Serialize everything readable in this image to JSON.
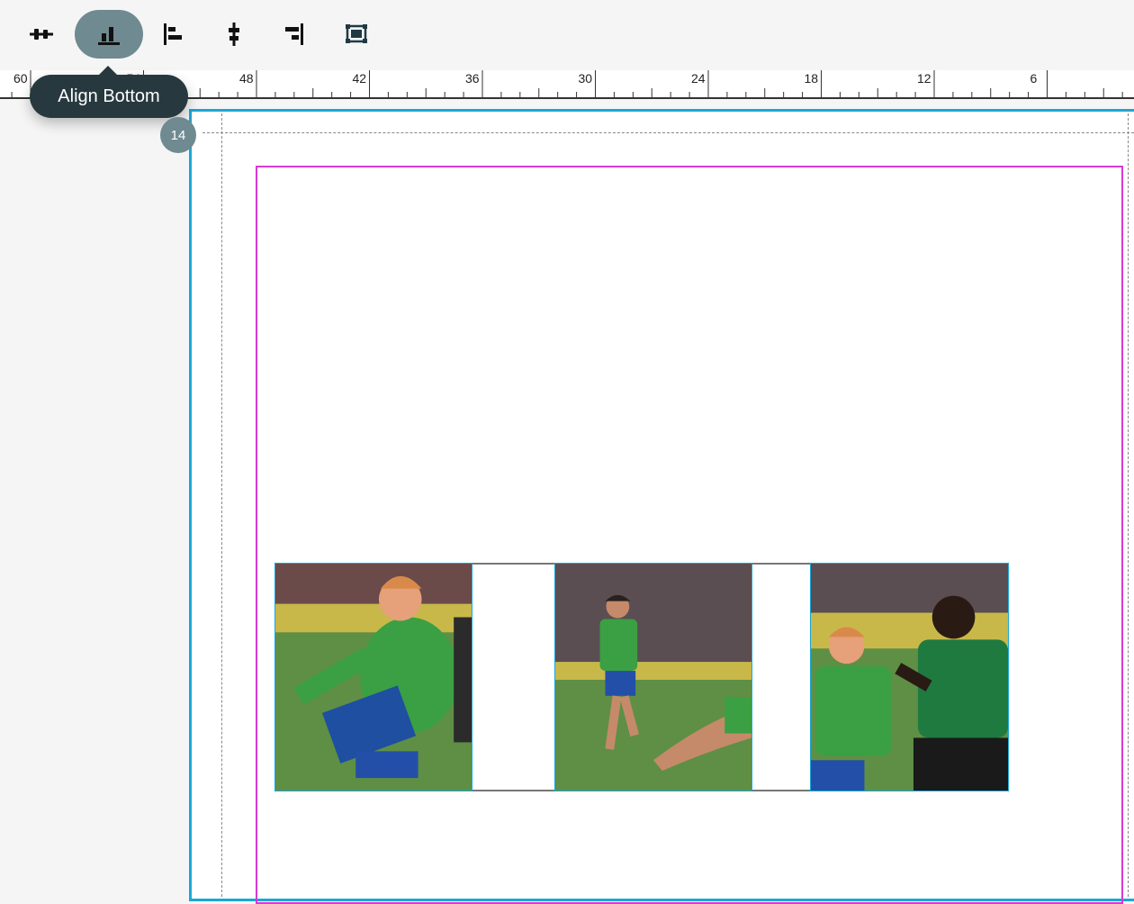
{
  "toolbar": {
    "buttons": [
      {
        "name": "distribute-horizontal-button",
        "icon": "distribute-horizontal-icon",
        "active": false
      },
      {
        "name": "align-bottom-button",
        "icon": "align-bottom-icon",
        "active": true
      },
      {
        "name": "align-left-button",
        "icon": "align-left-icon",
        "active": false
      },
      {
        "name": "align-center-button",
        "icon": "align-center-vertical-icon",
        "active": false
      },
      {
        "name": "align-right-button",
        "icon": "align-right-icon",
        "active": false
      },
      {
        "name": "fit-to-page-button",
        "icon": "frame-fit-icon",
        "active": false
      }
    ],
    "tooltip": "Align Bottom"
  },
  "ruler": {
    "labels": [
      "60",
      "54",
      "48",
      "42",
      "36",
      "30",
      "24",
      "18",
      "12",
      "6"
    ]
  },
  "canvas": {
    "page_badge": "14"
  },
  "colors": {
    "page_border": "#1aa7d6",
    "margin_guide": "#d63ad6",
    "active_button": "#6f8a90",
    "tooltip_bg": "#27393f"
  },
  "photos": [
    {
      "name": "photo-player-1",
      "description_icon": "soccer-photo"
    },
    {
      "name": "photo-player-2",
      "description_icon": "soccer-photo"
    },
    {
      "name": "photo-player-3",
      "description_icon": "soccer-photo"
    }
  ]
}
